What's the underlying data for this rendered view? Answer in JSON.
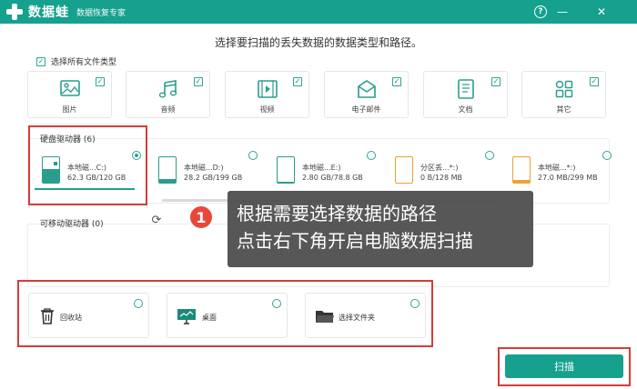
{
  "app": {
    "name": "数据蛙",
    "subtitle": "数据恢复专家"
  },
  "window_controls": {
    "help": "?",
    "minimize": "—",
    "close": "✕"
  },
  "heading": "选择要扫描的丢失数据的数据类型和路径。",
  "select_all": {
    "label": "选择所有文件类型",
    "checked": true
  },
  "file_types": [
    {
      "label": "图片",
      "icon": "image-icon",
      "checked": true
    },
    {
      "label": "音频",
      "icon": "music-note-icon",
      "checked": true
    },
    {
      "label": "视频",
      "icon": "film-icon",
      "checked": true
    },
    {
      "label": "电子邮件",
      "icon": "envelope-icon",
      "checked": true
    },
    {
      "label": "文档",
      "icon": "document-icon",
      "checked": true
    },
    {
      "label": "其它",
      "icon": "apps-grid-icon",
      "checked": true
    }
  ],
  "hard_disks": {
    "title": "硬盘驱动器 (6)",
    "drives": [
      {
        "name": "本地磁...C:)",
        "size": "62.3 GB/120 GB",
        "selected": true,
        "used_fraction": 0.52,
        "color": "#2a9d8e"
      },
      {
        "name": "本地磁...D:)",
        "size": "28.2 GB/199 GB",
        "selected": false,
        "used_fraction": 0.14,
        "color": "#2a9d8e"
      },
      {
        "name": "本地磁...E:)",
        "size": "2.80 GB/78.8 GB",
        "selected": false,
        "used_fraction": 0.04,
        "color": "#2a9d8e"
      },
      {
        "name": "分区丢...*:)",
        "size": "0 B/128 MB",
        "selected": false,
        "used_fraction": 0.0,
        "color": "#f0a030"
      },
      {
        "name": "本地磁...*:)",
        "size": "27.0 MB/299 MB",
        "selected": false,
        "used_fraction": 0.09,
        "color": "#f0a030"
      }
    ]
  },
  "removable": {
    "title": "可移动驱动器 (0)"
  },
  "tooltip": {
    "step": "1",
    "line1": "根据需要选择数据的路径",
    "line2": "点击右下角开启电脑数据扫描"
  },
  "locations": [
    {
      "label": "回收站",
      "icon": "recycle-bin-icon"
    },
    {
      "label": "桌面",
      "icon": "desktop-monitor-icon"
    },
    {
      "label": "选择文件夹",
      "icon": "folder-icon"
    }
  ],
  "scan_button": "扫描",
  "colors": {
    "brand": "#16a08e",
    "highlight": "#d83a3a",
    "accent_orange": "#f0a030"
  }
}
